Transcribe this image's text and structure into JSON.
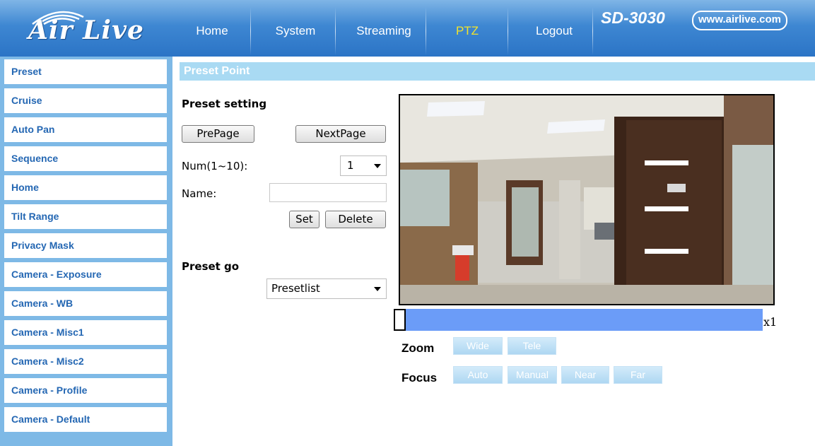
{
  "header": {
    "logo_text": "Air Live",
    "nav": [
      "Home",
      "System",
      "Streaming",
      "PTZ",
      "Logout"
    ],
    "active_nav": "PTZ",
    "model": "SD-3030",
    "url": "www.airlive.com"
  },
  "sidebar": {
    "items": [
      "Preset",
      "Cruise",
      "Auto Pan",
      "Sequence",
      "Home",
      "Tilt Range",
      "Privacy Mask",
      "Camera - Exposure",
      "Camera - WB",
      "Camera - Misc1",
      "Camera - Misc2",
      "Camera - Profile",
      "Camera - Default"
    ]
  },
  "section": {
    "title": "Preset Point"
  },
  "preset_setting": {
    "heading": "Preset setting",
    "prev_label": "PrePage",
    "next_label": "NextPage",
    "num_label": "Num(1~10):",
    "num_value": "1",
    "name_label": "Name:",
    "name_value": "",
    "set_label": "Set",
    "delete_label": "Delete"
  },
  "preset_go": {
    "heading": "Preset go",
    "select_value": "Presetlist"
  },
  "zoom": {
    "level_text": "x1",
    "position_fraction": 0.0,
    "label": "Zoom",
    "buttons": [
      "Wide",
      "Tele"
    ]
  },
  "focus": {
    "label": "Focus",
    "buttons": [
      "Auto",
      "Manual",
      "Near",
      "Far"
    ]
  },
  "colors": {
    "header": "#3e87d2",
    "sidebar": "#7eb9e6",
    "sidebar_text": "#2467b3",
    "active_nav": "#f3e32a",
    "section_bar": "#a9daf3",
    "zoom_bar": "#6b9cf8",
    "ptz_button": "#aed7f2"
  },
  "icons": {
    "logo": "airlive-wireless-arcs-logo",
    "select_caret": "caret-down-icon"
  }
}
